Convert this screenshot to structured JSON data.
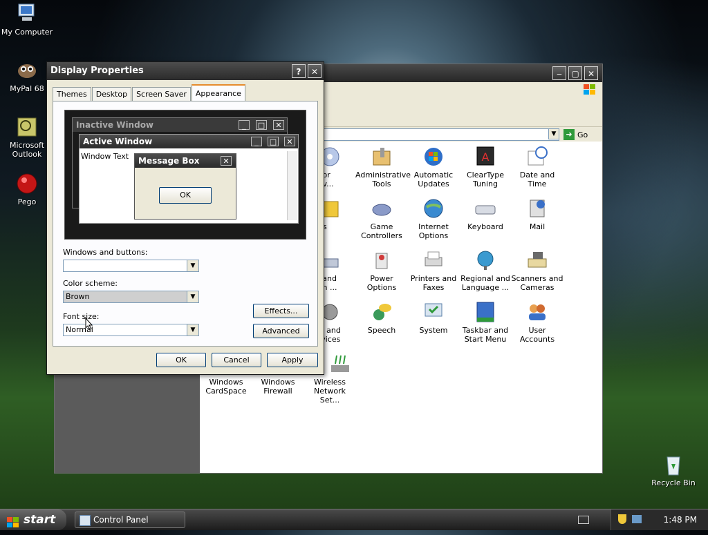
{
  "desktop": {
    "icons": [
      {
        "label": "My Computer"
      },
      {
        "label": "MyPal 68"
      },
      {
        "label": "Microsoft Outlook"
      },
      {
        "label": "Pego"
      },
      {
        "label": "Recycle Bin"
      }
    ]
  },
  "control_panel": {
    "address_go": "Go",
    "items": [
      {
        "label": "dd or\nmov..."
      },
      {
        "label": "Administrative Tools"
      },
      {
        "label": "Automatic Updates"
      },
      {
        "label": "ClearType Tuning"
      },
      {
        "label": "Date and Time"
      },
      {
        "label": "onts"
      },
      {
        "label": "Game Controllers"
      },
      {
        "label": "Internet Options"
      },
      {
        "label": "Keyboard"
      },
      {
        "label": "Mail"
      },
      {
        "label": "ne and\ndem ..."
      },
      {
        "label": "Power Options"
      },
      {
        "label": "Printers and Faxes"
      },
      {
        "label": "Regional and Language ..."
      },
      {
        "label": "Scanners and Cameras"
      },
      {
        "label": "nds and\nDevices"
      },
      {
        "label": "Speech"
      },
      {
        "label": "System"
      },
      {
        "label": "Taskbar and Start Menu"
      },
      {
        "label": "User Accounts"
      },
      {
        "label": "Windows CardSpace"
      },
      {
        "label": "Windows Firewall"
      },
      {
        "label": "Wireless Network Set..."
      }
    ]
  },
  "dialog": {
    "title": "Display Properties",
    "help_btn": "?",
    "close_btn": "✕",
    "tabs": [
      "Themes",
      "Desktop",
      "Screen Saver",
      "Appearance"
    ],
    "active_tab": "Appearance",
    "preview": {
      "inactive_title": "Inactive Window",
      "active_title": "Active Window",
      "window_text": "Window Text",
      "msgbox_title": "Message Box",
      "msgbox_ok": "OK"
    },
    "windows_buttons_label": "Windows and buttons:",
    "windows_buttons_value": "",
    "color_scheme_label": "Color scheme:",
    "color_scheme_value": "Brown",
    "font_size_label": "Font size:",
    "font_size_value": "Normal",
    "effects_btn": "Effects...",
    "advanced_btn": "Advanced",
    "ok_btn": "OK",
    "cancel_btn": "Cancel",
    "apply_btn": "Apply"
  },
  "taskbar": {
    "start_label": "start",
    "task_control_panel": "Control Panel",
    "clock": "1:48 PM"
  },
  "colors": {
    "accent_tab": "#e68b2c",
    "title_dark": "#2b2b2b",
    "dialog_bg": "#ece9d8"
  }
}
